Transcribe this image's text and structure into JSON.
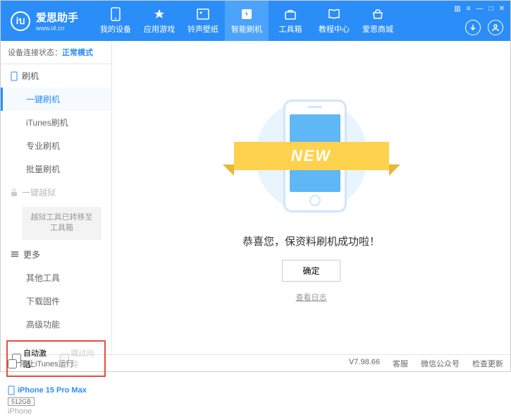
{
  "header": {
    "logo_letter": "iบ",
    "app_name": "爱思助手",
    "url": "www.i4.cn",
    "nav": [
      {
        "label": "我的设备"
      },
      {
        "label": "应用游戏"
      },
      {
        "label": "铃声壁纸"
      },
      {
        "label": "智能刷机"
      },
      {
        "label": "工具箱"
      },
      {
        "label": "教程中心"
      },
      {
        "label": "爱思商城"
      }
    ],
    "win_controls": [
      "▥",
      "≡",
      "—",
      "□",
      "✕"
    ]
  },
  "sidebar": {
    "status_label": "设备连接状态：",
    "status_value": "正常模式",
    "sections": {
      "flash": {
        "title": "刷机",
        "items": [
          "一键刷机",
          "iTunes刷机",
          "专业刷机",
          "批量刷机"
        ]
      },
      "jailbreak": {
        "title": "一键越狱",
        "note": "越狱工具已转移至工具箱"
      },
      "more": {
        "title": "更多",
        "items": [
          "其他工具",
          "下载固件",
          "高级功能"
        ]
      }
    },
    "checkboxes": {
      "auto_activate": "自动激活",
      "skip_guide": "跳过向导"
    },
    "device": {
      "name": "iPhone 15 Pro Max",
      "storage": "512GB",
      "type": "iPhone"
    }
  },
  "main": {
    "ribbon_text": "NEW",
    "success_message": "恭喜您，保资料刷机成功啦！",
    "ok_button": "确定",
    "view_log": "查看日志"
  },
  "footer": {
    "block_itunes": "阻止iTunes运行",
    "version": "V7.98.66",
    "links": [
      "客服",
      "微信公众号",
      "检查更新"
    ]
  }
}
